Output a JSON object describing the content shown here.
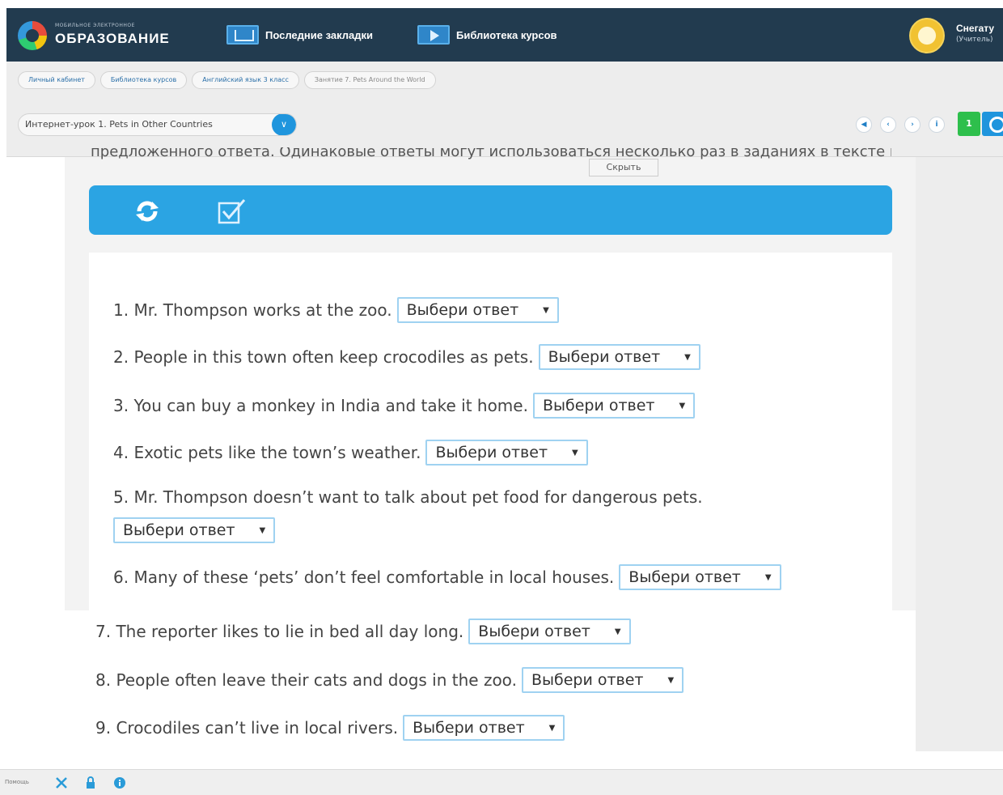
{
  "header": {
    "logo_small": "МОБИЛЬНОЕ ЭЛЕКТРОННОЕ",
    "logo_big": "ОБРАЗОВАНИЕ",
    "nav": [
      {
        "label": "Последние закладки",
        "icon": "bookmarks-icon"
      },
      {
        "label": "Библиотека курсов",
        "icon": "course-library-icon"
      }
    ],
    "user": {
      "name": "Снегату",
      "role": "(Учитель)"
    }
  },
  "breadcrumb": [
    "Личный кабинет",
    "Библиотека курсов",
    "Английский язык 3 класс",
    "Занятие 7. Pets Around the World"
  ],
  "lesson_select": {
    "value": "Интернет-урок 1. Pets in Other Countries"
  },
  "tools": {
    "green_counter": "1"
  },
  "clipped_text": "предложенного ответа. Одинаковые ответы могут использоваться несколько раз в заданиях в тексте источника",
  "hide_button": "Скрыть",
  "toolbar_icons": [
    "refresh-icon",
    "check-icon"
  ],
  "questions": [
    {
      "text": "1. Mr. Thompson works at the zoo.",
      "select": "Выбери ответ"
    },
    {
      "text": "2. People in this town often keep crocodiles as pets.",
      "select": "Выбери ответ"
    },
    {
      "text": "3. You can buy a monkey in India and take it home.",
      "select": "Выбери ответ"
    },
    {
      "text": "4. Exotic pets like the town’s weather.",
      "select": "Выбери ответ"
    },
    {
      "text": "5. Mr. Thompson doesn’t want to talk about pet food for dangerous pets.",
      "select": "Выбери ответ"
    },
    {
      "text": "6. Many of these ‘pets’ don’t feel comfortable in local houses.",
      "select": "Выбери ответ"
    },
    {
      "text": "7. The reporter likes to lie in bed all day long.",
      "select": "Выбери ответ"
    },
    {
      "text": "8. People often leave their cats and dogs in the zoo.",
      "select": "Выбери ответ"
    },
    {
      "text": "9. Crocodiles can’t live in local rivers.",
      "select": "Выбери ответ"
    }
  ],
  "footer": {
    "label": "Помощь"
  }
}
